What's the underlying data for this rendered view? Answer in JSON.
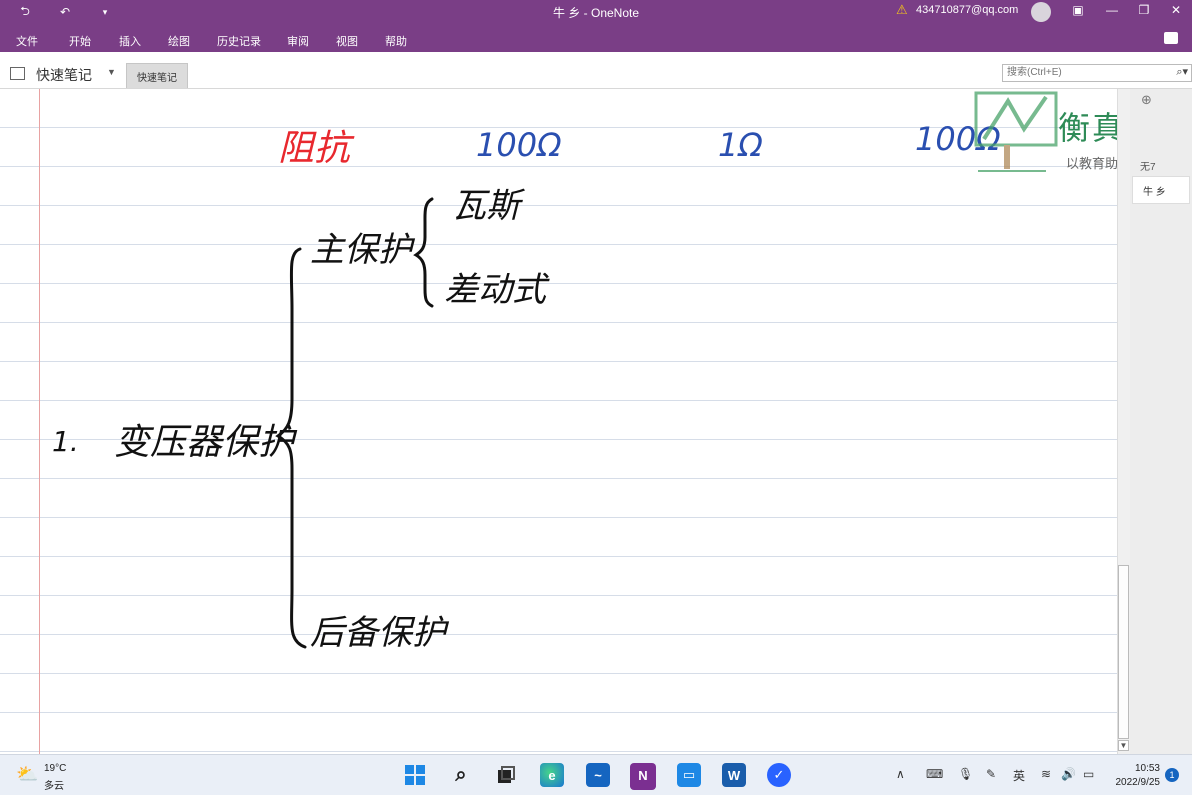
{
  "titlebar": {
    "title": "牛 乡  -  OneNote",
    "account": "434710877@qq.com"
  },
  "menu": [
    "文件",
    "开始",
    "插入",
    "绘图",
    "历史记录",
    "审阅",
    "视图",
    "帮助"
  ],
  "notebook": {
    "name": "快速笔记",
    "section_tab": "快速笔记"
  },
  "search": {
    "placeholder": "搜索(Ctrl+E)"
  },
  "pages": {
    "partial_tab": "无7",
    "current_page": "牛 乡"
  },
  "watermark": {
    "name": "衡真教",
    "slogan": "以教育助力行业发"
  },
  "notes": {
    "row1": [
      "阻抗",
      "100Ω",
      "1Ω",
      "100Ω"
    ],
    "row1_colors": [
      "#e8282e",
      "#2a4fb0",
      "#2a4fb0",
      "#2a4fb0"
    ],
    "item_number": "1.",
    "topic": "变压器保护",
    "main_branch": "主保护",
    "main_children": [
      "瓦斯",
      "差动式"
    ],
    "backup_branch": "后备保护"
  },
  "taskbar": {
    "weather_temp": "19°C",
    "weather_desc": "多云",
    "ime": "英",
    "time": "10:53",
    "date": "2022/9/25",
    "notifications": "1",
    "apps": [
      "windows-start",
      "search",
      "task-view",
      "edge",
      "whiteboard",
      "onenote",
      "remote-desktop",
      "word",
      "todo"
    ]
  }
}
